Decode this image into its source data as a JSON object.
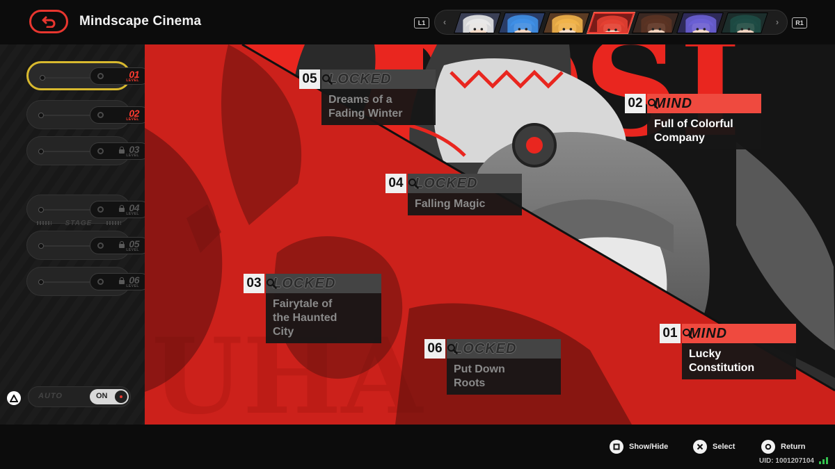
{
  "header": {
    "title": "Mindscape Cinema",
    "left_shoulder": "L1",
    "right_shoulder": "R1",
    "characters": [
      {
        "name": "character-1",
        "hair": "#e8e8e8",
        "skin": "#f4d9c6",
        "bg": "#3a3f55"
      },
      {
        "name": "character-2",
        "hair": "#3f8fe6",
        "skin": "#f3d6c3",
        "bg": "#2a3c66"
      },
      {
        "name": "character-3",
        "hair": "#f0b24a",
        "skin": "#f6dcc8",
        "bg": "#5a3b24"
      },
      {
        "name": "character-4",
        "hair": "#e34032",
        "skin": "#f6d8c6",
        "bg": "#7a1b18",
        "active": true
      },
      {
        "name": "character-5",
        "hair": "#5b3324",
        "skin": "#f1d2bd",
        "bg": "#3a2822"
      },
      {
        "name": "character-6",
        "hair": "#6a5fd4",
        "skin": "#f3d8c8",
        "bg": "#2e2a58"
      },
      {
        "name": "character-7",
        "hair": "#1e4d45",
        "skin": "#efd2c0",
        "bg": "#1c2e2c"
      }
    ]
  },
  "sidebar": {
    "levels": [
      {
        "num": "01",
        "tag": "LEVEL",
        "selected": true,
        "locked": false
      },
      {
        "num": "02",
        "tag": "LEVEL",
        "selected": false,
        "locked": false
      },
      {
        "num": "03",
        "tag": "LEVEL",
        "selected": false,
        "locked": true
      },
      {
        "num": "04",
        "tag": "LEVEL",
        "selected": false,
        "locked": true
      },
      {
        "num": "05",
        "tag": "LEVEL",
        "selected": false,
        "locked": true
      },
      {
        "num": "06",
        "tag": "LEVEL",
        "selected": false,
        "locked": true
      }
    ],
    "stage_label": "STAGE",
    "auto_label": "AUTO",
    "auto_state": "ON"
  },
  "cards": [
    {
      "num": "05",
      "status": "LOCKED",
      "title_lines": [
        "Dreams of a",
        "Fading Winter"
      ],
      "unlocked": false
    },
    {
      "num": "02",
      "status": "MIND",
      "title_lines": [
        "Full of Colorful",
        "Company"
      ],
      "unlocked": true
    },
    {
      "num": "04",
      "status": "LOCKED",
      "title_lines": [
        "Falling Magic"
      ],
      "unlocked": false
    },
    {
      "num": "03",
      "status": "LOCKED",
      "title_lines": [
        "Fairytale of",
        "the Haunted",
        "City"
      ],
      "unlocked": false
    },
    {
      "num": "01",
      "status": "MIND",
      "title_lines": [
        "Lucky",
        "Constitution"
      ],
      "unlocked": true
    },
    {
      "num": "06",
      "status": "LOCKED",
      "title_lines": [
        "Put Down",
        "Roots"
      ],
      "unlocked": false
    }
  ],
  "footer": {
    "hints": [
      {
        "glyph": "square-icon",
        "label": "Show/Hide"
      },
      {
        "glyph": "cross-icon",
        "label": "Select"
      },
      {
        "glyph": "circle-icon",
        "label": "Return"
      }
    ],
    "uid": "UID: 1001207104"
  },
  "colors": {
    "accent": "#e8362f",
    "selected_outline": "#d8b92e",
    "art_red": "#e9261f",
    "signal": "#35c24f"
  }
}
